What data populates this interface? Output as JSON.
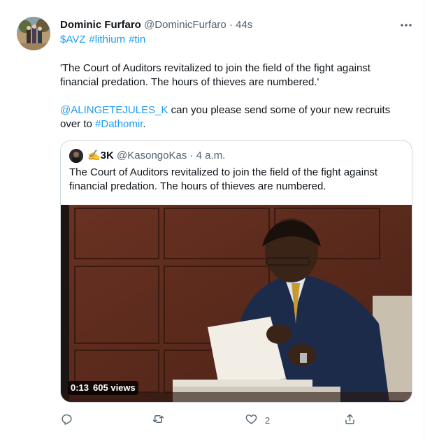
{
  "tweet": {
    "author_name": "Dominic Furfaro",
    "author_handle": "@DominicFurfaro",
    "separator": "·",
    "time": "44s",
    "more_icon": "more-horizontal-icon",
    "tags": [
      "$AVZ",
      "#lithium",
      "#tin"
    ],
    "paragraph1": "'The Court of Auditors revitalized to join the field of the fight against financial predation. The hours of thieves are numbered.'",
    "mention": "@ALINGETEJULES_K",
    "paragraph2_mid": " can you please send some of your new recruits over to ",
    "paragraph2_hashtag": "#Dathomir",
    "paragraph2_end": "."
  },
  "quote": {
    "author_name": "✍️3K",
    "author_handle": "@KasongoKas",
    "separator": "·",
    "time": "4 a.m.",
    "text": "The Court of Auditors revitalized to join the field of the fight against financial predation. The hours of thieves are numbered.",
    "video": {
      "duration": "0:13",
      "views": "605 views"
    }
  },
  "actions": {
    "reply_icon": "reply-icon",
    "retweet_icon": "retweet-icon",
    "like_icon": "heart-icon",
    "like_count": "2",
    "share_icon": "share-icon"
  },
  "colors": {
    "link": "#1d9bf0",
    "muted": "#536471",
    "border": "#cfd9de"
  }
}
